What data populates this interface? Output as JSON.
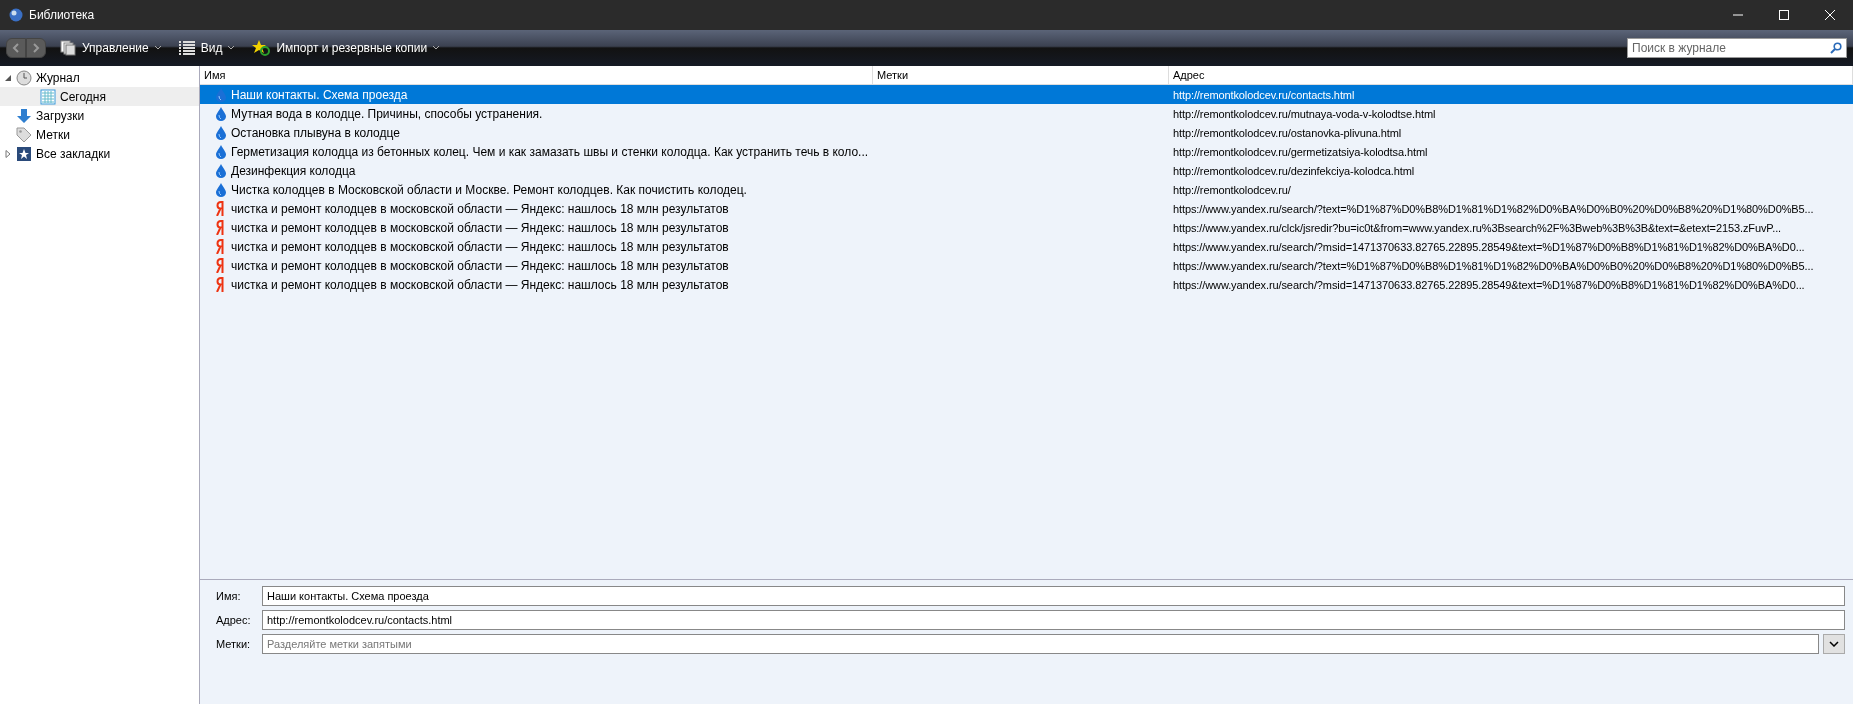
{
  "window": {
    "title": "Библиотека"
  },
  "toolbar": {
    "menus": [
      {
        "label": "Управление",
        "kind": "pages"
      },
      {
        "label": "Вид",
        "kind": "list"
      },
      {
        "label": "Импорт и резервные копии",
        "kind": "star"
      }
    ],
    "search": {
      "placeholder": "Поиск в журнале"
    }
  },
  "sidebar": {
    "items": [
      {
        "label": "Журнал",
        "kind": "clock",
        "expanded": true,
        "selected": false,
        "children": [
          {
            "label": "Сегодня",
            "kind": "calendar",
            "selected": true
          }
        ]
      },
      {
        "label": "Загрузки",
        "kind": "download",
        "selected": false
      },
      {
        "label": "Метки",
        "kind": "tag",
        "selected": false
      },
      {
        "label": "Все закладки",
        "kind": "star",
        "expanded": false,
        "selected": false
      }
    ]
  },
  "table": {
    "columns": [
      "Имя",
      "Метки",
      "Адрес"
    ],
    "rows": [
      {
        "name": "Наши контакты. Схема проезда",
        "address": "http://remontkolodcev.ru/contacts.html",
        "kind": "drop",
        "selected": true
      },
      {
        "name": "Мутная вода в колодце. Причины, способы устранения.",
        "address": "http://remontkolodcev.ru/mutnaya-voda-v-kolodtse.html",
        "kind": "drop",
        "selected": false
      },
      {
        "name": "Остановка плывуна в колодце",
        "address": "http://remontkolodcev.ru/ostanovka-plivuna.html",
        "kind": "drop",
        "selected": false
      },
      {
        "name": "Герметизация колодца из бетонных колец. Чем и как замазать швы и стенки колодца. Как устранить течь в коло...",
        "address": "http://remontkolodcev.ru/germetizatsiya-kolodtsa.html",
        "kind": "drop",
        "selected": false
      },
      {
        "name": "Дезинфекция колодца",
        "address": "http://remontkolodcev.ru/dezinfekciya-kolodca.html",
        "kind": "drop",
        "selected": false
      },
      {
        "name": "Чистка колодцев в Московской области и Москве. Ремонт колодцев. Как почистить колодец.",
        "address": "http://remontkolodcev.ru/",
        "kind": "drop",
        "selected": false
      },
      {
        "name": "чистка и ремонт колодцев в московской области — Яндекс: нашлось 18 млн результатов",
        "address": "https://www.yandex.ru/search/?text=%D1%87%D0%B8%D1%81%D1%82%D0%BA%D0%B0%20%D0%B8%20%D1%80%D0%B5...",
        "kind": "yandex",
        "selected": false
      },
      {
        "name": "чистка и ремонт колодцев в московской области — Яндекс: нашлось 18 млн результатов",
        "address": "https://www.yandex.ru/clck/jsredir?bu=ic0t&from=www.yandex.ru%3Bsearch%2F%3Bweb%3B%3B&text=&etext=2153.zFuvP...",
        "kind": "yandex",
        "selected": false
      },
      {
        "name": "чистка и ремонт колодцев в московской области — Яндекс: нашлось 18 млн результатов",
        "address": "https://www.yandex.ru/search/?msid=1471370633.82765.22895.28549&text=%D1%87%D0%B8%D1%81%D1%82%D0%BA%D0...",
        "kind": "yandex",
        "selected": false
      },
      {
        "name": "чистка и ремонт колодцев в московской области — Яндекс: нашлось 18 млн результатов",
        "address": "https://www.yandex.ru/search/?text=%D1%87%D0%B8%D1%81%D1%82%D0%BA%D0%B0%20%D0%B8%20%D1%80%D0%B5...",
        "kind": "yandex",
        "selected": false
      },
      {
        "name": "чистка и ремонт колодцев в московской области — Яндекс: нашлось 18 млн результатов",
        "address": "https://www.yandex.ru/search/?msid=1471370633.82765.22895.28549&text=%D1%87%D0%B8%D1%81%D1%82%D0%BA%D0...",
        "kind": "yandex",
        "selected": false
      }
    ]
  },
  "details": {
    "fields": [
      {
        "label": "Имя:",
        "value": "Наши контакты. Схема проезда",
        "kind": "text"
      },
      {
        "label": "Адрес:",
        "value": "http://remontkolodcev.ru/contacts.html",
        "kind": "text"
      },
      {
        "label": "Метки:",
        "placeholder": "Разделяйте метки запятыми",
        "kind": "tags"
      }
    ]
  }
}
